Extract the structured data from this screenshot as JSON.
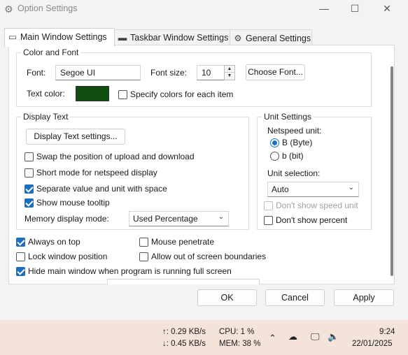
{
  "window": {
    "title": "Option Settings",
    "minimize": "—",
    "maximize": "☐",
    "close": "✕"
  },
  "tabs": [
    {
      "label": "Main Window Settings",
      "icon": "window-icon",
      "active": true
    },
    {
      "label": "Taskbar Window Settings",
      "icon": "taskbar-icon",
      "active": false
    },
    {
      "label": "General Settings",
      "icon": "gear-icon",
      "active": false
    }
  ],
  "color_font": {
    "group_title": "Color and Font",
    "font_label": "Font:",
    "font_value": "Segoe UI",
    "font_size_label": "Font size:",
    "font_size_value": "10",
    "choose_font_button": "Choose Font...",
    "text_color_label": "Text color:",
    "text_color": "#0e4d0e",
    "specify_colors_label": "Specify colors for each item",
    "specify_colors_checked": false
  },
  "display_text": {
    "group_title": "Display Text",
    "settings_button": "Display Text settings...",
    "options": [
      {
        "label": "Swap the position of upload and download",
        "checked": false
      },
      {
        "label": "Short mode for netspeed display",
        "checked": false
      },
      {
        "label": "Separate value and unit with space",
        "checked": true
      },
      {
        "label": "Show mouse tooltip",
        "checked": true
      }
    ],
    "memory_mode_label": "Memory display mode:",
    "memory_mode_value": "Used Percentage"
  },
  "unit_settings": {
    "group_title": "Unit Settings",
    "netspeed_unit_label": "Netspeed unit:",
    "radio_byte": "B (Byte)",
    "radio_bit": "b (bit)",
    "selected": "byte",
    "unit_selection_label": "Unit selection:",
    "unit_selection_value": "Auto",
    "dont_show_speed_unit": "Don't show speed unit",
    "dont_show_speed_unit_checked": false,
    "dont_show_percent": "Don't show percent",
    "dont_show_percent_checked": false
  },
  "bottom_options": [
    {
      "label": "Always on top",
      "checked": true
    },
    {
      "label": "Mouse penetrate",
      "checked": false
    },
    {
      "label": "Lock window position",
      "checked": false
    },
    {
      "label": "Allow out of screen boundaries",
      "checked": false
    },
    {
      "label": "Hide main window when program is running full screen",
      "checked": true
    }
  ],
  "buttons": {
    "ok": "OK",
    "cancel": "Cancel",
    "apply": "Apply"
  },
  "taskbar": {
    "upload": "↑: 0.29 KB/s",
    "download": "↓: 0.45 KB/s",
    "cpu": "CPU: 1 %",
    "mem": "MEM: 38 %",
    "time": "9:24",
    "date": "22/01/2025"
  },
  "colors": {
    "accent": "#1a6fc0",
    "taskbar_bg": "#f3e3d8"
  }
}
